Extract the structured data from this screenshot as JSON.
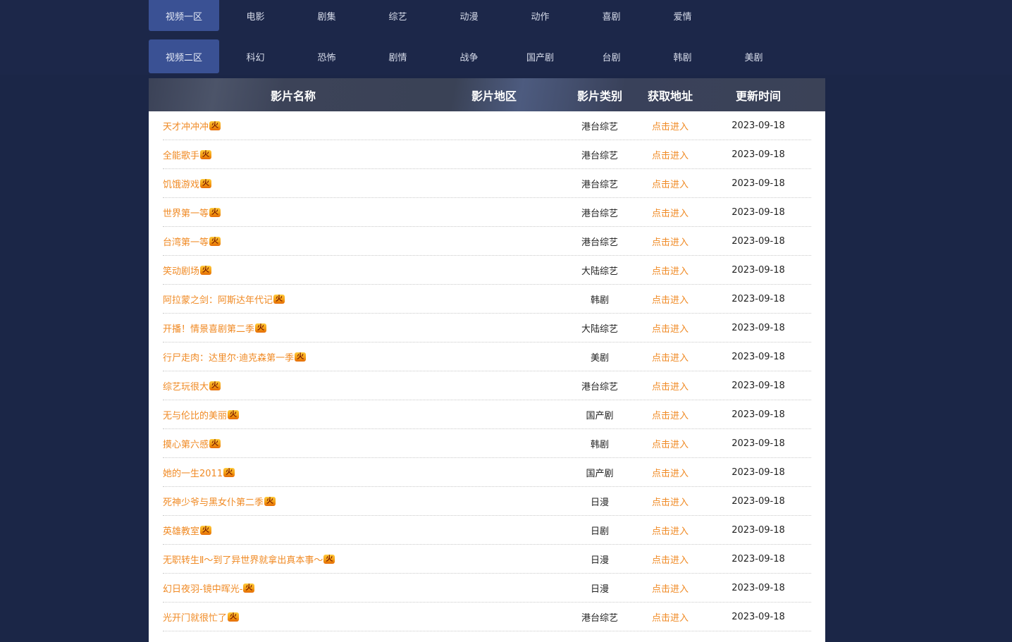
{
  "nav": {
    "row1": {
      "head": "视频一区",
      "items": [
        "电影",
        "剧集",
        "综艺",
        "动漫",
        "动作",
        "喜剧",
        "爱情"
      ]
    },
    "row2": {
      "head": "视频二区",
      "items": [
        "科幻",
        "恐怖",
        "剧情",
        "战争",
        "国产剧",
        "台剧",
        "韩剧",
        "美剧"
      ]
    }
  },
  "table": {
    "headers": {
      "name": "影片名称",
      "region": "影片地区",
      "type": "影片类别",
      "link": "获取地址",
      "time": "更新时间"
    },
    "hot_badge": "火",
    "rows": [
      {
        "name": "天才冲冲冲",
        "type": "港台综艺",
        "link": "点击进入",
        "time": "2023-09-18"
      },
      {
        "name": "全能歌手",
        "type": "港台综艺",
        "link": "点击进入",
        "time": "2023-09-18"
      },
      {
        "name": "饥饿游戏",
        "type": "港台综艺",
        "link": "点击进入",
        "time": "2023-09-18"
      },
      {
        "name": "世界第一等",
        "type": "港台综艺",
        "link": "点击进入",
        "time": "2023-09-18"
      },
      {
        "name": "台湾第一等",
        "type": "港台综艺",
        "link": "点击进入",
        "time": "2023-09-18"
      },
      {
        "name": "笑动剧场",
        "type": "大陆综艺",
        "link": "点击进入",
        "time": "2023-09-18"
      },
      {
        "name": "阿拉蒙之剑：阿斯达年代记",
        "type": "韩剧",
        "link": "点击进入",
        "time": "2023-09-18"
      },
      {
        "name": "开播！情景喜剧第二季",
        "type": "大陆综艺",
        "link": "点击进入",
        "time": "2023-09-18"
      },
      {
        "name": "行尸走肉：达里尔·迪克森第一季",
        "type": "美剧",
        "link": "点击进入",
        "time": "2023-09-18"
      },
      {
        "name": "综艺玩很大",
        "type": "港台综艺",
        "link": "点击进入",
        "time": "2023-09-18"
      },
      {
        "name": "无与伦比的美丽",
        "type": "国产剧",
        "link": "点击进入",
        "time": "2023-09-18"
      },
      {
        "name": "摸心第六感",
        "type": "韩剧",
        "link": "点击进入",
        "time": "2023-09-18"
      },
      {
        "name": "她的一生2011",
        "type": "国产剧",
        "link": "点击进入",
        "time": "2023-09-18"
      },
      {
        "name": "死神少爷与黑女仆第二季",
        "type": "日漫",
        "link": "点击进入",
        "time": "2023-09-18"
      },
      {
        "name": "英雄教室",
        "type": "日剧",
        "link": "点击进入",
        "time": "2023-09-18"
      },
      {
        "name": "无职转生Ⅱ～到了异世界就拿出真本事～",
        "type": "日漫",
        "link": "点击进入",
        "time": "2023-09-18"
      },
      {
        "name": "幻日夜羽-镜中晖光-",
        "type": "日漫",
        "link": "点击进入",
        "time": "2023-09-18"
      },
      {
        "name": "光开门就很忙了",
        "type": "港台综艺",
        "link": "点击进入",
        "time": "2023-09-18"
      }
    ]
  },
  "colors": {
    "page_bg": "#1b2647",
    "nav_active": "#3a5194",
    "link": "#f08a24"
  }
}
